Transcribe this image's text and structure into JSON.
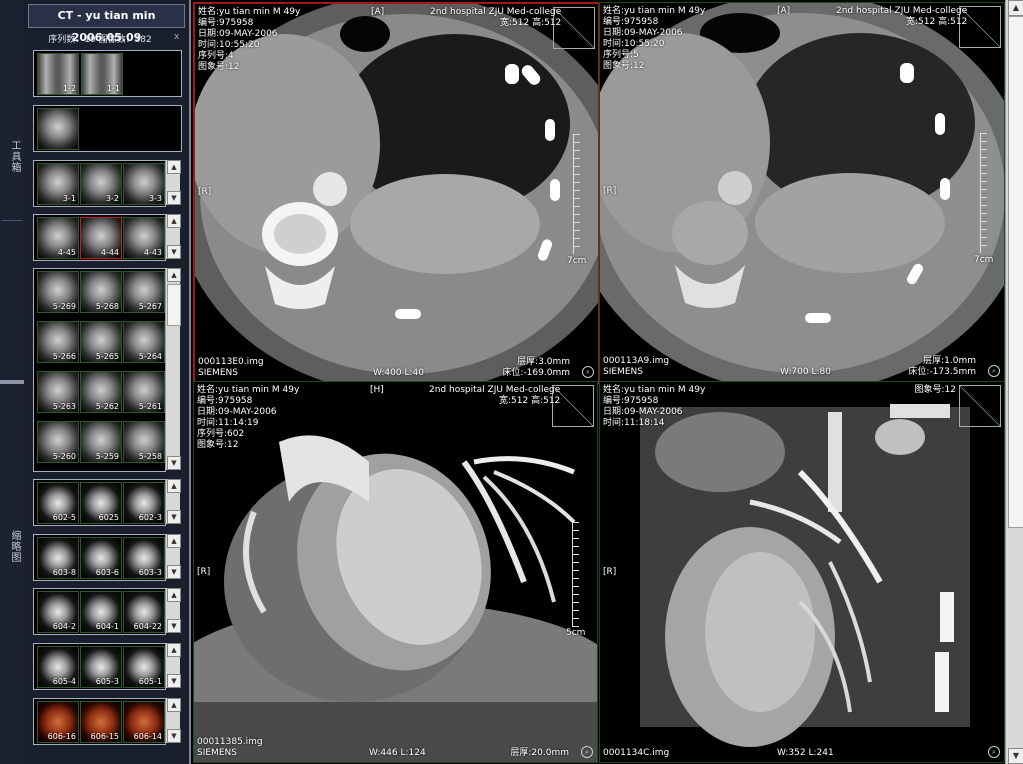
{
  "sidebar": {
    "tools_tab": "工具箱",
    "thumbs_tab": "缩略图"
  },
  "panel": {
    "title": "CT - yu tian min 2006.05.09",
    "counts": "序列数：10 图像数：382",
    "close": "x",
    "series": [
      {
        "thumbs": [
          "1-2",
          "1-1"
        ]
      },
      {
        "thumbs": [
          ""
        ]
      },
      {
        "thumbs": [
          "3-1",
          "3-2",
          "3-3"
        ]
      },
      {
        "thumbs": [
          "4-45",
          "4-44",
          "4-43"
        ]
      },
      {
        "thumbs": [
          "5-269",
          "5-268",
          "5-267",
          "5-266",
          "5-265",
          "5-264",
          "5-263",
          "5-262",
          "5-261",
          "5-260",
          "5-259",
          "5-258"
        ]
      },
      {
        "thumbs": [
          "602-5",
          "6025",
          "602-3"
        ]
      },
      {
        "thumbs": [
          "603-8",
          "603-6",
          "603-3"
        ]
      },
      {
        "thumbs": [
          "604-2",
          "604-1",
          "604-22"
        ]
      },
      {
        "thumbs": [
          "605-4",
          "605-3",
          "605-1"
        ]
      },
      {
        "thumbs": [
          "606-16",
          "606-15",
          "606-14"
        ]
      }
    ]
  },
  "viewers": [
    {
      "orient_top": "[A]",
      "orient_left": "[R]",
      "name": "姓名:yu tian min  M 49y",
      "id": "编号:975958",
      "date": "日期:09-MAY-2006",
      "time": "时间:10:55:20",
      "series_no": "序列号:4",
      "image_no": "图象号:12",
      "hospital": "2nd hospital ZJU Med-college",
      "matrix": "宽:512  高:512",
      "scale": "7cm",
      "file": "000113E0.img",
      "maker": "SIEMENS",
      "window": "W:400 L:40",
      "thickness": "层厚:3.0mm",
      "position": "床位:-169.0mm"
    },
    {
      "orient_top": "[A]",
      "orient_left": "[R]",
      "name": "姓名:yu tian min  M 49y",
      "id": "编号:975958",
      "date": "日期:09-MAY-2006",
      "time": "时间:10:55:20",
      "series_no": "序列号:5",
      "image_no": "图象号:12",
      "hospital": "2nd hospital ZJU Med-college",
      "matrix": "宽:512  高:512",
      "scale": "7cm",
      "file": "000113A9.img",
      "maker": "SIEMENS",
      "window": "W:700 L:80",
      "thickness": "层厚:1.0mm",
      "position": "床位:-173.5mm"
    },
    {
      "orient_top": "[H]",
      "orient_left": "[R]",
      "name": "姓名:yu tian min  M 49y",
      "id": "编号:975958",
      "date": "日期:09-MAY-2006",
      "time": "时间:11:14:19",
      "series_no": "序列号:602",
      "image_no": "图象号:12",
      "hospital": "2nd hospital ZJU Med-college",
      "matrix": "宽:512  高:512",
      "scale": "5cm",
      "file": "00011385.img",
      "maker": "SIEMENS",
      "window": "W:446 L:124",
      "thickness": "层厚:20.0mm",
      "position": ""
    },
    {
      "orient_top": "",
      "orient_left": "[R]",
      "name": "姓名:yu tian min  M 49y",
      "id": "编号:975958",
      "date": "日期:09-MAY-2006",
      "time": "时间:11:18:14",
      "series_no": "",
      "image_no": "图象号:12",
      "hospital": "",
      "matrix": "",
      "scale": "",
      "file": "0001134C.img",
      "maker": "",
      "window": "W:352 L:241",
      "thickness": "",
      "position": ""
    }
  ]
}
